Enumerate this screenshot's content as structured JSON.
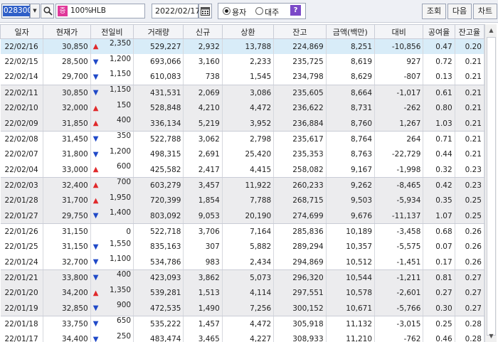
{
  "toolbar": {
    "code": "028300",
    "jeung_label": "증",
    "ratio": "100%",
    "stock_name": "HLB",
    "date": "2022/02/17",
    "radio_shares": "용자",
    "radio_lending": "대주",
    "help_label": "?",
    "query_label": "조회",
    "next_label": "다음",
    "chart_label": "차트"
  },
  "table": {
    "headers": [
      "일자",
      "현재가",
      "전일비",
      "거래량",
      "신규",
      "상환",
      "잔고",
      "금액(백만)",
      "대비",
      "공여율",
      "잔고율"
    ],
    "rows": [
      [
        "22/02/16",
        "30,850",
        "up",
        "2,350",
        "529,227",
        "2,932",
        "13,788",
        "224,869",
        "8,251",
        "-10,856",
        "0.47",
        "0.20"
      ],
      [
        "22/02/15",
        "28,500",
        "down",
        "1,200",
        "693,066",
        "3,160",
        "2,233",
        "235,725",
        "8,619",
        "927",
        "0.72",
        "0.21"
      ],
      [
        "22/02/14",
        "29,700",
        "down",
        "1,150",
        "610,083",
        "738",
        "1,545",
        "234,798",
        "8,629",
        "-807",
        "0.13",
        "0.21"
      ],
      [
        "22/02/11",
        "30,850",
        "down",
        "1,150",
        "431,531",
        "2,069",
        "3,086",
        "235,605",
        "8,664",
        "-1,017",
        "0.61",
        "0.21"
      ],
      [
        "22/02/10",
        "32,000",
        "up",
        "150",
        "528,848",
        "4,210",
        "4,472",
        "236,622",
        "8,731",
        "-262",
        "0.80",
        "0.21"
      ],
      [
        "22/02/09",
        "31,850",
        "up",
        "400",
        "336,134",
        "5,219",
        "3,952",
        "236,884",
        "8,760",
        "1,267",
        "1.03",
        "0.21"
      ],
      [
        "22/02/08",
        "31,450",
        "down",
        "350",
        "522,788",
        "3,062",
        "2,798",
        "235,617",
        "8,764",
        "264",
        "0.71",
        "0.21"
      ],
      [
        "22/02/07",
        "31,800",
        "down",
        "1,200",
        "498,315",
        "2,691",
        "25,420",
        "235,353",
        "8,763",
        "-22,729",
        "0.44",
        "0.21"
      ],
      [
        "22/02/04",
        "33,000",
        "up",
        "600",
        "425,582",
        "2,417",
        "4,415",
        "258,082",
        "9,167",
        "-1,998",
        "0.32",
        "0.23"
      ],
      [
        "22/02/03",
        "32,400",
        "up",
        "700",
        "603,279",
        "3,457",
        "11,922",
        "260,233",
        "9,262",
        "-8,465",
        "0.42",
        "0.23"
      ],
      [
        "22/01/28",
        "31,700",
        "up",
        "1,950",
        "720,399",
        "1,854",
        "7,788",
        "268,715",
        "9,503",
        "-5,934",
        "0.35",
        "0.25"
      ],
      [
        "22/01/27",
        "29,750",
        "down",
        "1,400",
        "803,092",
        "9,053",
        "20,190",
        "274,699",
        "9,676",
        "-11,137",
        "1.07",
        "0.25"
      ],
      [
        "22/01/26",
        "31,150",
        "flat",
        "0",
        "522,718",
        "3,706",
        "7,164",
        "285,836",
        "10,189",
        "-3,458",
        "0.68",
        "0.26"
      ],
      [
        "22/01/25",
        "31,150",
        "down",
        "1,550",
        "835,163",
        "307",
        "5,882",
        "289,294",
        "10,357",
        "-5,575",
        "0.07",
        "0.26"
      ],
      [
        "22/01/24",
        "32,700",
        "down",
        "1,100",
        "534,786",
        "983",
        "2,434",
        "294,869",
        "10,512",
        "-1,451",
        "0.17",
        "0.26"
      ],
      [
        "22/01/21",
        "33,800",
        "down",
        "400",
        "423,093",
        "3,862",
        "5,073",
        "296,320",
        "10,544",
        "-1,211",
        "0.81",
        "0.27"
      ],
      [
        "22/01/20",
        "34,200",
        "up",
        "1,350",
        "539,281",
        "1,513",
        "4,114",
        "297,551",
        "10,578",
        "-2,601",
        "0.27",
        "0.27"
      ],
      [
        "22/01/19",
        "32,850",
        "down",
        "900",
        "472,535",
        "1,490",
        "7,256",
        "300,152",
        "10,671",
        "-5,766",
        "0.30",
        "0.27"
      ],
      [
        "22/01/18",
        "33,750",
        "down",
        "650",
        "535,222",
        "1,457",
        "4,472",
        "305,918",
        "11,132",
        "-3,015",
        "0.25",
        "0.28"
      ],
      [
        "22/01/17",
        "34,400",
        "down",
        "250",
        "483,474",
        "3,465",
        "4,227",
        "308,933",
        "11,210",
        "-762",
        "0.46",
        "0.28"
      ]
    ]
  },
  "colors": {
    "up": "#e0292b",
    "down": "#1f49c8",
    "selected_row": "#d8ecf8",
    "tinted_row": "#ececee"
  },
  "icons": {
    "search": "search-icon",
    "calendar": "calendar-icon",
    "dropdown": "chevron-down-icon"
  }
}
